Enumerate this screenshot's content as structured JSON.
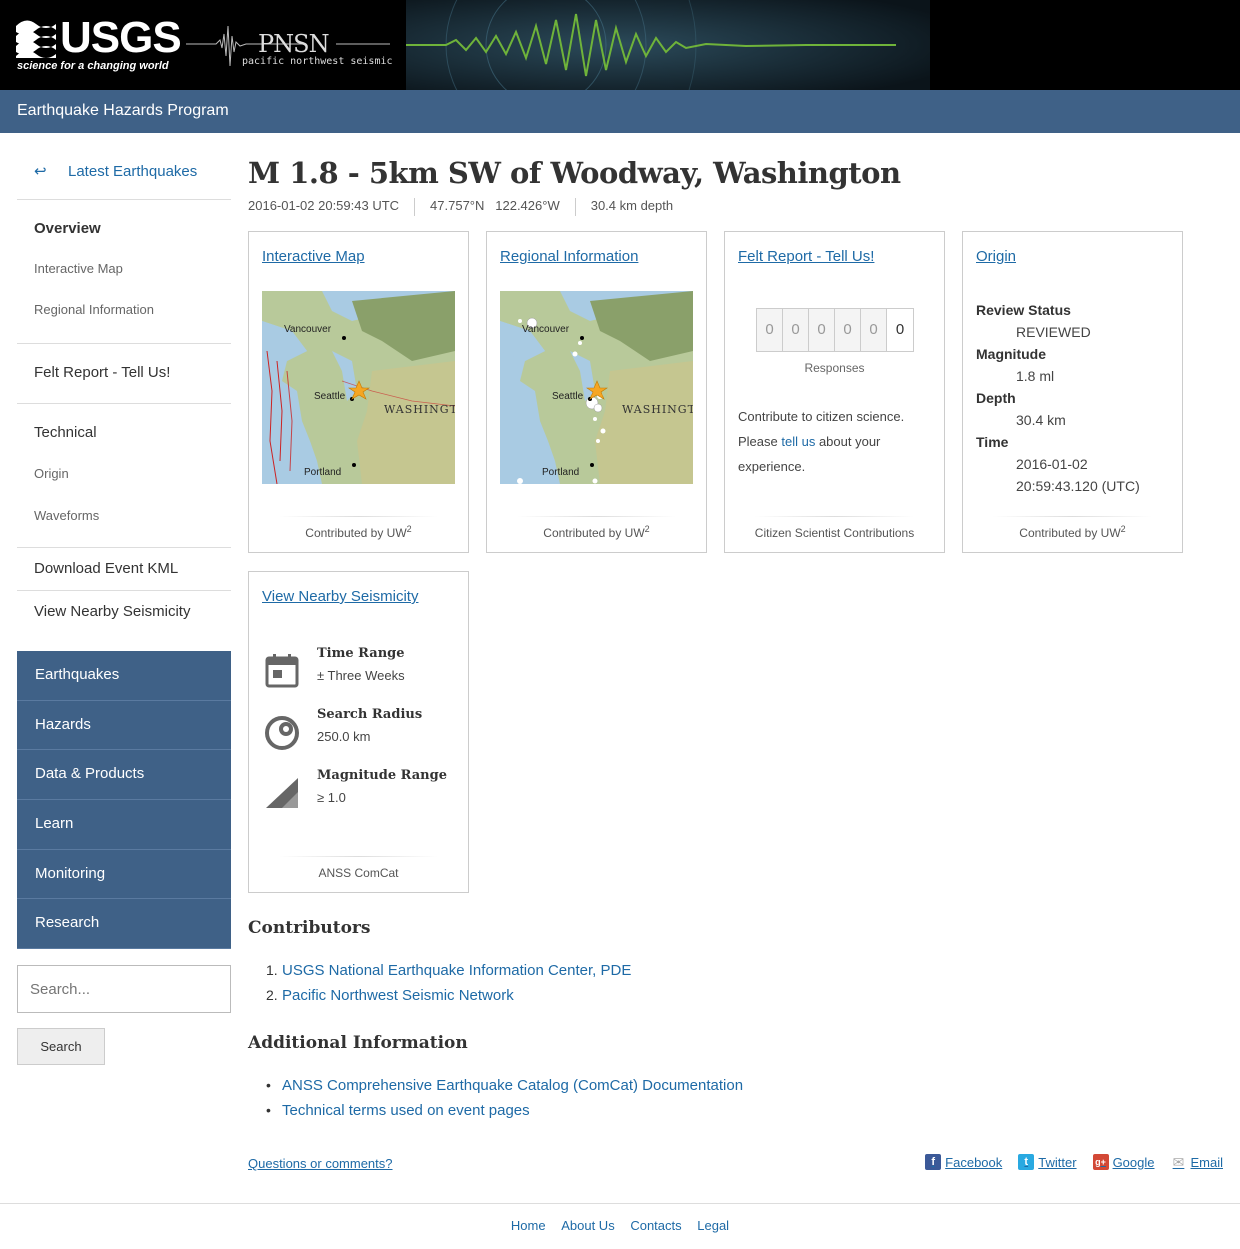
{
  "header": {
    "usgs_logo_text": "USGS",
    "usgs_tagline": "science for a changing world",
    "pnsn_title": "PNSN",
    "pnsn_subtitle": "pacific northwest seismic"
  },
  "program_bar": {
    "title": "Earthquake Hazards Program"
  },
  "sidebar": {
    "back_label": "Latest Earthquakes",
    "group1": [
      {
        "label": "Overview"
      },
      {
        "label": "Interactive Map"
      },
      {
        "label": "Regional Information"
      }
    ],
    "group2": [
      {
        "label": "Felt Report - Tell Us!"
      }
    ],
    "group3": [
      {
        "label": "Technical"
      },
      {
        "label": "Origin"
      },
      {
        "label": "Waveforms"
      }
    ],
    "group4": [
      {
        "label": "Download Event KML"
      }
    ],
    "group5": [
      {
        "label": "View Nearby Seismicity"
      }
    ]
  },
  "section_nav": [
    {
      "label": "Earthquakes"
    },
    {
      "label": "Hazards"
    },
    {
      "label": "Data & Products"
    },
    {
      "label": "Learn"
    },
    {
      "label": "Monitoring"
    },
    {
      "label": "Research"
    }
  ],
  "search": {
    "placeholder": "Search...",
    "button_label": "Search"
  },
  "event": {
    "title": "M 1.8 - 5km SW of Woodway, Washington",
    "time": "2016-01-02 20:59:43 UTC",
    "lat": "47.757°N",
    "lon": "122.426°W",
    "depth": "30.4 km depth"
  },
  "cards": {
    "interactive_map": {
      "title": "Interactive Map",
      "footer": "Contributed by UW",
      "footer_sup": "2",
      "labels": {
        "vancouver": "Vancouver",
        "seattle": "Seattle",
        "washington": "WASHINGT",
        "portland": "Portland"
      }
    },
    "regional": {
      "title": "Regional Information",
      "footer": "Contributed by UW",
      "footer_sup": "2",
      "labels": {
        "vancouver": "Vancouver",
        "seattle": "Seattle",
        "washington": "WASHINGT",
        "portland": "Portland"
      }
    },
    "felt": {
      "title": "Felt Report - Tell Us!",
      "digits": [
        "0",
        "0",
        "0",
        "0",
        "0",
        "0"
      ],
      "counter_label": "Responses",
      "text_before": "Contribute to citizen science. Please ",
      "link_text": "tell us",
      "text_after": " about your experience.",
      "footer": "Citizen Scientist Contributions"
    },
    "origin": {
      "title": "Origin",
      "review_status_label": "Review Status",
      "review_status": "REVIEWED",
      "magnitude_label": "Magnitude",
      "magnitude": "1.8 ml",
      "depth_label": "Depth",
      "depth": "30.4 km",
      "time_label": "Time",
      "date": "2016-01-02",
      "time": "20:59:43.120 (UTC)",
      "footer": "Contributed by UW",
      "footer_sup": "2"
    },
    "seismicity": {
      "title": "View Nearby Seismicity",
      "time_range_label": "Time Range",
      "time_range": "± Three Weeks",
      "radius_label": "Search Radius",
      "radius": "250.0 km",
      "mag_label": "Magnitude Range",
      "mag": "≥ 1.0",
      "footer": "ANSS ComCat"
    }
  },
  "contributors": {
    "heading": "Contributors",
    "items": [
      {
        "num": "1.",
        "label": "USGS National Earthquake Information Center, PDE"
      },
      {
        "num": "2.",
        "label": "Pacific Northwest Seismic Network"
      }
    ]
  },
  "additional": {
    "heading": "Additional Information",
    "items": [
      {
        "label": "ANSS Comprehensive Earthquake Catalog (ComCat) Documentation"
      },
      {
        "label": "Technical terms used on event pages"
      }
    ]
  },
  "questions_link": "Questions or comments?",
  "share": [
    {
      "label": "Facebook",
      "icon": "facebook-icon",
      "color": "#3b5998",
      "glyph": "f"
    },
    {
      "label": "Twitter",
      "icon": "twitter-icon",
      "color": "#29a9e1",
      "glyph": "t"
    },
    {
      "label": "Google",
      "icon": "google-icon",
      "color": "#d34836",
      "glyph": "g+"
    },
    {
      "label": "Email",
      "icon": "email-icon",
      "color": "#aaaaaa",
      "glyph": "✉"
    }
  ],
  "footer": {
    "links": [
      {
        "label": "Home"
      },
      {
        "label": "About Us"
      },
      {
        "label": "Contacts"
      },
      {
        "label": "Legal"
      }
    ]
  }
}
